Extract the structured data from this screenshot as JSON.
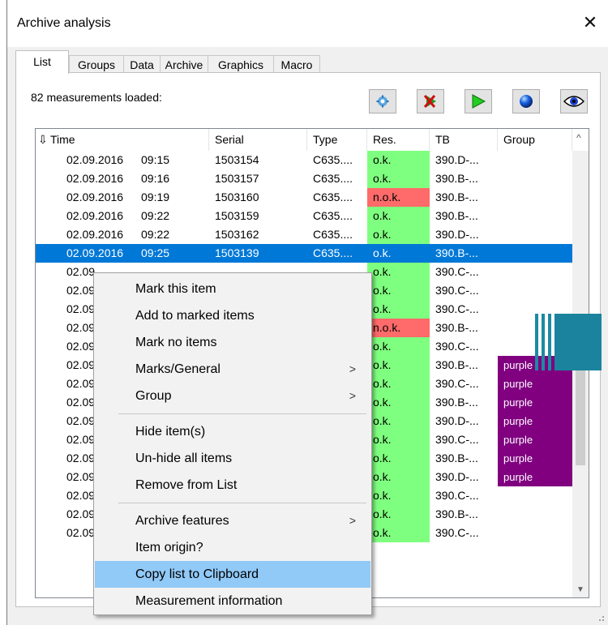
{
  "window": {
    "title": "Archive analysis"
  },
  "tabs": [
    "List",
    "Groups",
    "Data",
    "Archive",
    "Graphics",
    "Macro"
  ],
  "status": "82 measurements loaded:",
  "toolbar": [
    {
      "icon": "settings-gear-icon"
    },
    {
      "icon": "run-stop-icon"
    },
    {
      "icon": "play-icon"
    },
    {
      "icon": "globe-icon"
    },
    {
      "icon": "eye-icon"
    }
  ],
  "columns": {
    "time": "Time",
    "serial": "Serial",
    "type": "Type",
    "res": "Res.",
    "tb": "TB",
    "group": "Group"
  },
  "rows": [
    {
      "date": "02.09.2016",
      "time": "09:15",
      "serial": "1503154",
      "type": "C635....",
      "res": "o.k.",
      "tb": "390.D-...",
      "group": ""
    },
    {
      "date": "02.09.2016",
      "time": "09:16",
      "serial": "1503157",
      "type": "C635....",
      "res": "o.k.",
      "tb": "390.B-...",
      "group": ""
    },
    {
      "date": "02.09.2016",
      "time": "09:19",
      "serial": "1503160",
      "type": "C635....",
      "res": "n.o.k.",
      "tb": "390.B-...",
      "group": ""
    },
    {
      "date": "02.09.2016",
      "time": "09:22",
      "serial": "1503159",
      "type": "C635....",
      "res": "o.k.",
      "tb": "390.B-...",
      "group": ""
    },
    {
      "date": "02.09.2016",
      "time": "09:22",
      "serial": "1503162",
      "type": "C635....",
      "res": "o.k.",
      "tb": "390.D-...",
      "group": ""
    },
    {
      "date": "02.09.2016",
      "time": "09:25",
      "serial": "1503139",
      "type": "C635....",
      "res": "o.k.",
      "tb": "390.B-...",
      "group": "",
      "selected": true
    },
    {
      "date": "02.09",
      "time": "",
      "serial": "",
      "type": "",
      "res": "o.k.",
      "tb": "390.C-...",
      "group": ""
    },
    {
      "date": "02.09",
      "time": "",
      "serial": "",
      "type": "",
      "res": "o.k.",
      "tb": "390.C-...",
      "group": ""
    },
    {
      "date": "02.09",
      "time": "",
      "serial": "",
      "type": "",
      "res": "o.k.",
      "tb": "390.C-...",
      "group": ""
    },
    {
      "date": "02.09",
      "time": "",
      "serial": "",
      "type": "",
      "res": "n.o.k.",
      "tb": "390.B-...",
      "group": ""
    },
    {
      "date": "02.09",
      "time": "",
      "serial": "",
      "type": "",
      "res": "o.k.",
      "tb": "390.C-...",
      "group": ""
    },
    {
      "date": "02.09",
      "time": "",
      "serial": "",
      "type": "",
      "res": "o.k.",
      "tb": "390.B-...",
      "group": "purple"
    },
    {
      "date": "02.09",
      "time": "",
      "serial": "",
      "type": "",
      "res": "o.k.",
      "tb": "390.C-...",
      "group": "purple"
    },
    {
      "date": "02.09",
      "time": "",
      "serial": "",
      "type": "",
      "res": "o.k.",
      "tb": "390.B-...",
      "group": "purple"
    },
    {
      "date": "02.09",
      "time": "",
      "serial": "",
      "type": "",
      "res": "o.k.",
      "tb": "390.D-...",
      "group": "purple"
    },
    {
      "date": "02.09",
      "time": "",
      "serial": "",
      "type": "",
      "res": "o.k.",
      "tb": "390.C-...",
      "group": "purple"
    },
    {
      "date": "02.09",
      "time": "",
      "serial": "",
      "type": "",
      "res": "o.k.",
      "tb": "390.B-...",
      "group": "purple"
    },
    {
      "date": "02.09",
      "time": "",
      "serial": "",
      "type": "",
      "res": "o.k.",
      "tb": "390.D-...",
      "group": "purple"
    },
    {
      "date": "02.09",
      "time": "",
      "serial": "",
      "type": "",
      "res": "o.k.",
      "tb": "390.C-...",
      "group": ""
    },
    {
      "date": "02.09",
      "time": "",
      "serial": "",
      "type": "",
      "res": "o.k.",
      "tb": "390.B-...",
      "group": ""
    },
    {
      "date": "02.09",
      "time": "",
      "serial": "",
      "type": "",
      "res": "o.k.",
      "tb": "390.C-...",
      "group": ""
    }
  ],
  "context_menu": [
    {
      "label": "Mark this item",
      "submenu": false
    },
    {
      "label": "Add to marked items",
      "submenu": false
    },
    {
      "label": "Mark no items",
      "submenu": false
    },
    {
      "label": "Marks/General",
      "submenu": true
    },
    {
      "label": "Group",
      "submenu": true
    },
    {
      "separator": true
    },
    {
      "label": "Hide item(s)",
      "submenu": false
    },
    {
      "label": "Un-hide all items",
      "submenu": false
    },
    {
      "label": "Remove from List",
      "submenu": false
    },
    {
      "separator": true
    },
    {
      "label": "Archive features",
      "submenu": true
    },
    {
      "label": "Item origin?",
      "submenu": false
    },
    {
      "label": "Copy list to Clipboard",
      "submenu": false,
      "highlighted": true
    },
    {
      "label": "Measurement information",
      "submenu": false
    }
  ],
  "colors": {
    "ok": "#7fff7f",
    "nok": "#ff6a6a",
    "purple": "#800080",
    "selection": "#0078d7",
    "menu_highlight": "#91c9f7"
  }
}
